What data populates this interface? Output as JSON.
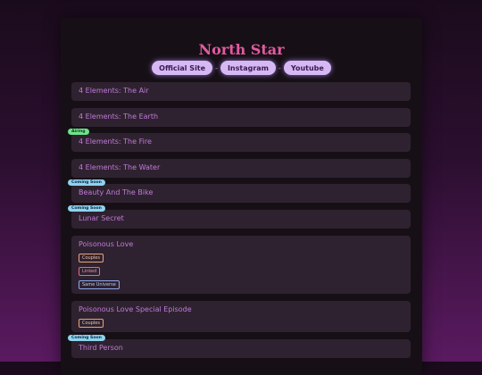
{
  "header": {
    "title": "North Star"
  },
  "links": [
    {
      "label": "Official Site"
    },
    {
      "label": "Instagram"
    },
    {
      "label": "Youtube"
    }
  ],
  "separator": "-",
  "badges": {
    "airing": "Airing",
    "soon": "Coming Soon"
  },
  "tags": {
    "couples": "Couples",
    "linked": "Linked",
    "universe": "Same Universe"
  },
  "shows": [
    {
      "title": "4 Elements: The Air"
    },
    {
      "title": "4 Elements: The Earth"
    },
    {
      "title": "4 Elements: The Fire",
      "status": "Airing"
    },
    {
      "title": "4 Elements: The Water"
    },
    {
      "title": "Beauty And The Bike",
      "status": "Coming Soon"
    },
    {
      "title": "Lunar Secret",
      "status": "Coming Soon"
    },
    {
      "title": "Poisonous Love",
      "tags": [
        "Couples",
        "Linked",
        "Same Universe"
      ]
    },
    {
      "title": "Poisonous Love Special Episode",
      "tags": [
        "Couples"
      ]
    },
    {
      "title": "Third Person",
      "status": "Coming Soon"
    }
  ],
  "colors": {
    "accent_title": "#e25aa0",
    "link_button": "#d6b8f2",
    "item_bg": "#2f2230",
    "item_text": "#c07ad8",
    "airing": "#6ee38a",
    "coming_soon": "#8fd3ee"
  }
}
